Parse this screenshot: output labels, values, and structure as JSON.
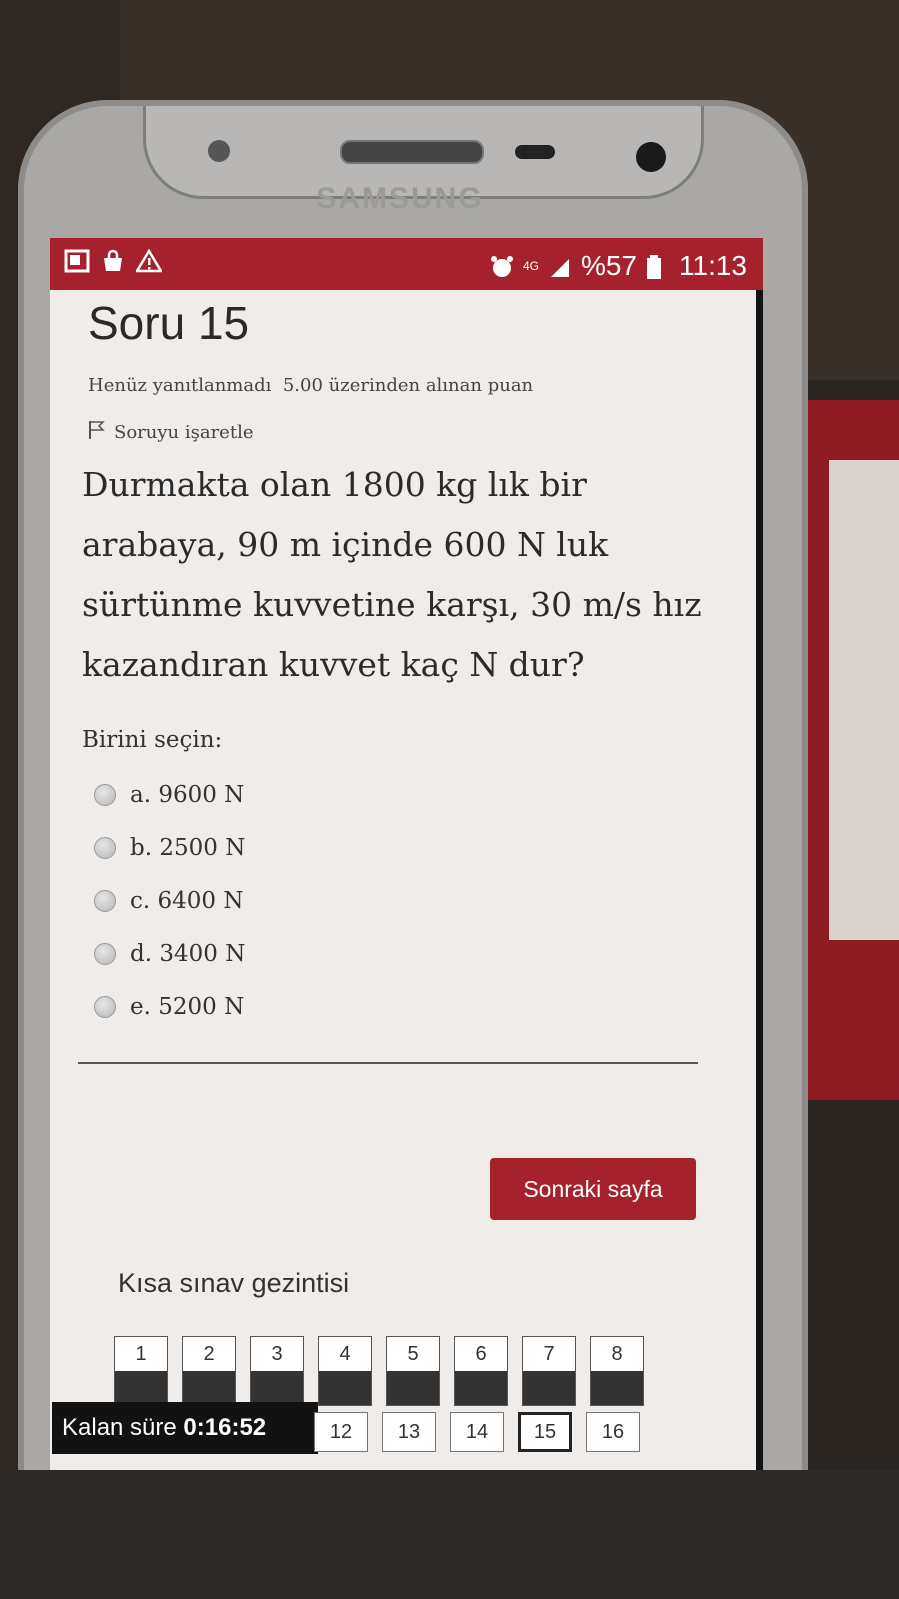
{
  "device": {
    "brand": "SAMSUNG"
  },
  "statusbar": {
    "icons_left": [
      "image-icon",
      "shopping-bag-icon",
      "warning-icon"
    ],
    "alarm_icon": "alarm-icon",
    "network": "4G",
    "battery": "%57",
    "time": "11:13"
  },
  "question": {
    "title": "Soru 15",
    "status": "Henüz yanıtlanmadı",
    "points": "5.00 üzerinden alınan puan",
    "flag_label": "Soruyu işaretle",
    "text": "Durmakta olan 1800 kg lık bir arabaya, 90 m içinde 600 N luk sürtünme kuvvetine karşı, 30 m/s hız kazandıran kuvvet kaç N dur?",
    "choose_label": "Birini seçin:",
    "options": [
      {
        "label": "a. 9600 N"
      },
      {
        "label": "b. 2500 N"
      },
      {
        "label": "c. 6400 N"
      },
      {
        "label": "d. 3400 N"
      },
      {
        "label": "e. 5200 N"
      }
    ]
  },
  "next_button": "Sonraki sayfa",
  "navigation": {
    "title": "Kısa sınav gezintisi",
    "row1": [
      "1",
      "2",
      "3",
      "4",
      "5",
      "6",
      "7",
      "8"
    ],
    "row2": [
      "12",
      "13",
      "14",
      "15",
      "16"
    ],
    "current": "15"
  },
  "timer": {
    "label": "Kalan süre",
    "value": "0:16:52"
  },
  "colors": {
    "accent": "#a5212c"
  }
}
